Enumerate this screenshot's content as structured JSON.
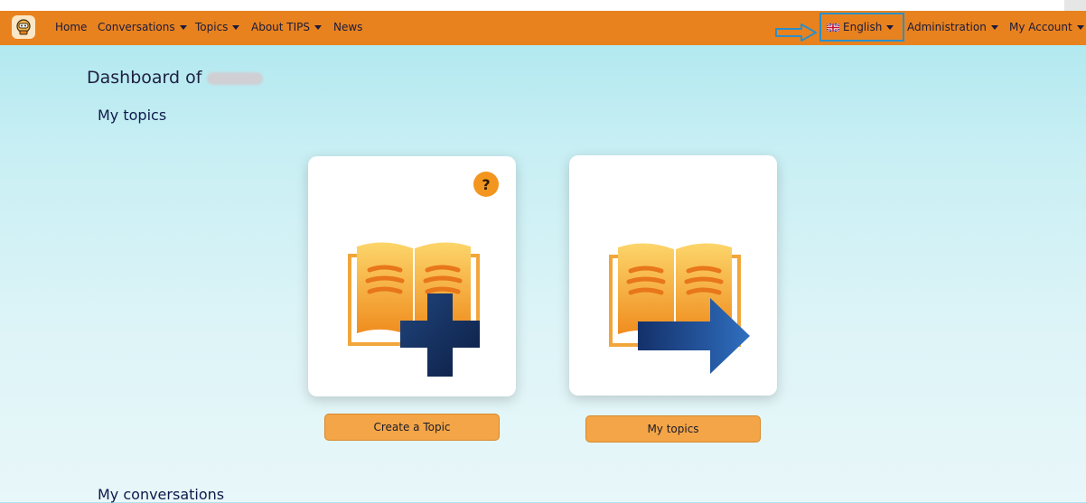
{
  "nav": {
    "items": [
      "Home",
      "Conversations",
      "Topics",
      "About TIPS",
      "News"
    ],
    "language": "English",
    "administration": "Administration",
    "account": "My Account"
  },
  "dashboard": {
    "title_prefix": "Dashboard of"
  },
  "sections": {
    "my_topics": "My topics",
    "my_conversations": "My conversations"
  },
  "cards": {
    "help_symbol": "?",
    "create_label": "Create a Topic",
    "mytopics_label": "My topics"
  },
  "colors": {
    "navbar": "#e8821e",
    "button": "#f3a547",
    "accent_blue": "#2c8fc9"
  }
}
